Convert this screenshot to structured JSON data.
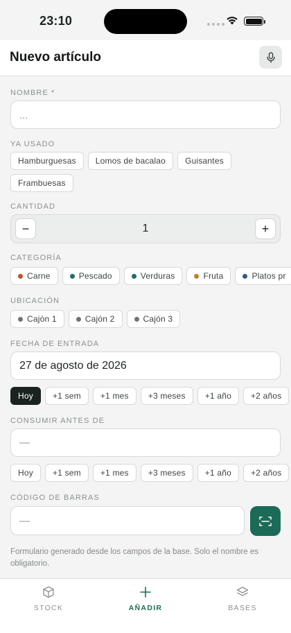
{
  "status_bar": {
    "time": "23:10"
  },
  "header": {
    "title": "Nuevo artículo",
    "mic_icon": "microphone-icon"
  },
  "form": {
    "nombre": {
      "label": "NOMBRE *",
      "placeholder": "..."
    },
    "ya_usado": {
      "label": "YA USADO",
      "chips": [
        "Hamburguesas",
        "Lomos de bacalao",
        "Guisantes",
        "Frambuesas"
      ]
    },
    "cantidad": {
      "label": "CANTIDAD",
      "minus": "−",
      "value": "1",
      "plus": "+"
    },
    "categoria": {
      "label": "CATEGORÍA",
      "chips": [
        {
          "label": "Carne",
          "color": "#c4512b"
        },
        {
          "label": "Pescado",
          "color": "#1f6f60"
        },
        {
          "label": "Verduras",
          "color": "#1f6f60"
        },
        {
          "label": "Fruta",
          "color": "#c0812a"
        },
        {
          "label": "Platos pr",
          "color": "#2f5b83"
        }
      ]
    },
    "ubicacion": {
      "label": "UBICACIÓN",
      "chips": [
        {
          "label": "Cajón 1",
          "color": "#6f7471"
        },
        {
          "label": "Cajón 2",
          "color": "#6f7471"
        },
        {
          "label": "Cajón 3",
          "color": "#6f7471"
        }
      ]
    },
    "fecha_entrada": {
      "label": "FECHA DE ENTRADA",
      "value": "27 de agosto de 2026",
      "quick": [
        "Hoy",
        "+1 sem",
        "+1 mes",
        "+3 meses",
        "+1 año",
        "+2 años"
      ],
      "active_index": 0
    },
    "consumir_antes": {
      "label": "CONSUMIR ANTES DE",
      "value": "—",
      "quick": [
        "Hoy",
        "+1 sem",
        "+1 mes",
        "+3 meses",
        "+1 año",
        "+2 años"
      ]
    },
    "codigo_barras": {
      "label": "CÓDIGO DE BARRAS",
      "value": "—",
      "scan_icon": "barcode-scan-icon"
    },
    "footnote": "Formulario generado desde los campos de la base. Solo el nombre es obligatorio."
  },
  "tabbar": {
    "tabs": [
      {
        "label": "STOCK",
        "icon": "box-icon"
      },
      {
        "label": "AÑADIR",
        "icon": "plus-icon"
      },
      {
        "label": "BASES",
        "icon": "layers-icon"
      }
    ],
    "active": "AÑADIR",
    "accent": "#1b6b58"
  }
}
